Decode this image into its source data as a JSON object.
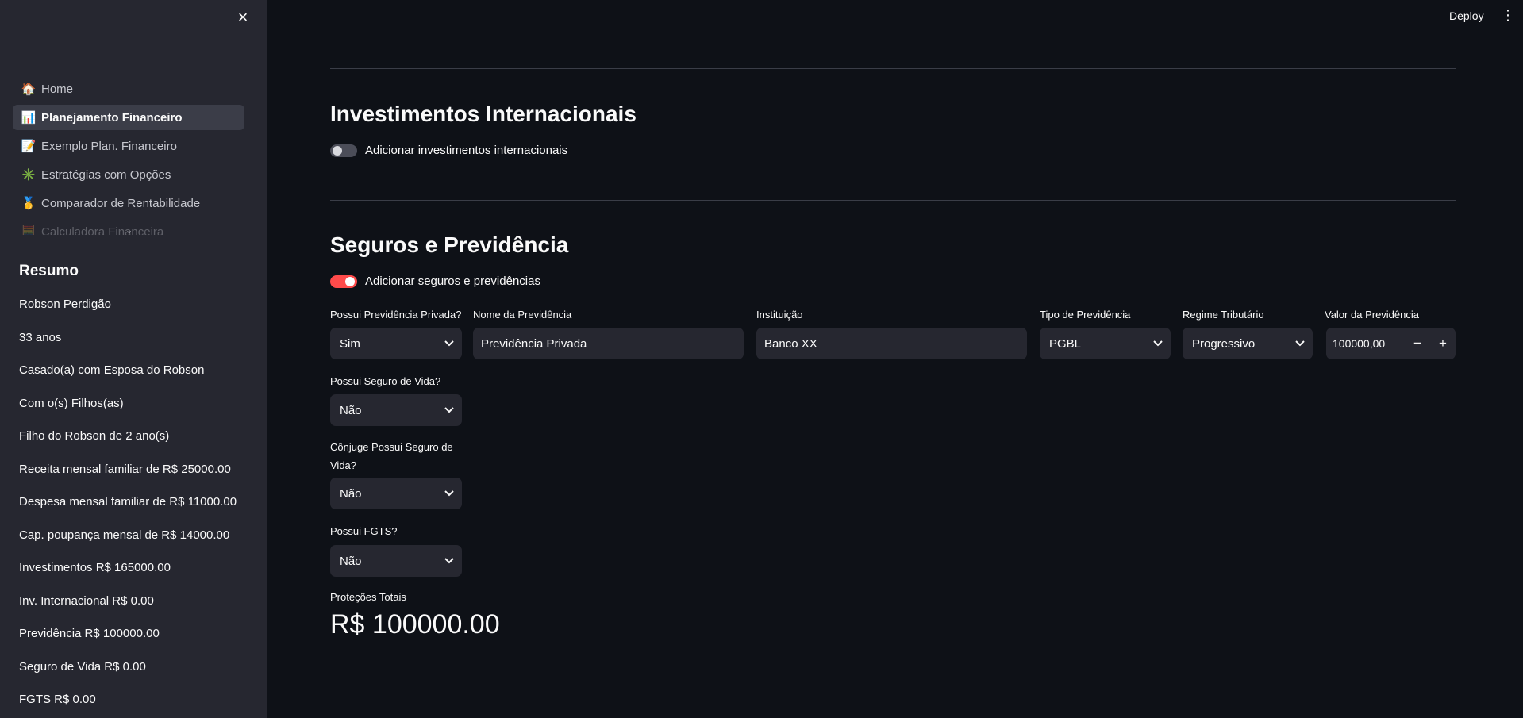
{
  "header": {
    "deploy_label": "Deploy",
    "menu_icon": "kebab-menu-icon"
  },
  "sidebar": {
    "close_icon": "close-icon",
    "nav": [
      {
        "emoji": "🏠",
        "label": "Home",
        "active": false
      },
      {
        "emoji": "📊",
        "label": "Planejamento Financeiro",
        "active": true
      },
      {
        "emoji": "📝",
        "label": "Exemplo Plan. Financeiro",
        "active": false
      },
      {
        "emoji": "✳️",
        "label": "Estratégias com Opções",
        "active": false
      },
      {
        "emoji": "🥇",
        "label": "Comparador de Rentabilidade",
        "active": false
      },
      {
        "emoji": "🧮",
        "label": "Calculadora Financeira",
        "active": false
      }
    ],
    "summary_title": "Resumo",
    "summary_lines": [
      "Robson Perdigão",
      "33 anos",
      "Casado(a) com Esposa do Robson",
      "Com o(s) Filhos(as)",
      "Filho do Robson de 2 ano(s)",
      "Receita mensal familiar de R$ 25000.00",
      "Despesa mensal familiar de R$ 11000.00",
      "Cap. poupança mensal de R$ 14000.00",
      "Investimentos R$ 165000.00",
      "Inv. Internacional R$ 0.00",
      "Previdência R$ 100000.00",
      "Seguro de Vida R$ 0.00",
      "FGTS R$ 0.00"
    ]
  },
  "international": {
    "title": "Investimentos Internacionais",
    "toggle_label": "Adicionar investimentos internacionais",
    "toggle_on": false
  },
  "insurance": {
    "title": "Seguros e Previdência",
    "toggle_label": "Adicionar seguros e previdências",
    "toggle_on": true,
    "fields": {
      "has_pension_label": "Possui Previdência Privada?",
      "has_pension_value": "Sim",
      "pension_name_label": "Nome da Previdência",
      "pension_name_value": "Previdência Privada",
      "institution_label": "Instituição",
      "institution_value": "Banco XX",
      "pension_type_label": "Tipo de Previdência",
      "pension_type_value": "PGBL",
      "tax_regime_label": "Regime Tributário",
      "tax_regime_value": "Progressivo",
      "pension_value_label": "Valor da Previdência",
      "pension_value_value": "100000,00",
      "minus": "−",
      "plus": "+",
      "life_insurance_label": "Possui Seguro de Vida?",
      "life_insurance_value": "Não",
      "spouse_life_label": "Cônjuge Possui Seguro de Vida?",
      "spouse_life_value": "Não",
      "fgts_label": "Possui FGTS?",
      "fgts_value": "Não"
    },
    "metric_label": "Proteções Totais",
    "metric_value": "R$ 100000.00"
  }
}
